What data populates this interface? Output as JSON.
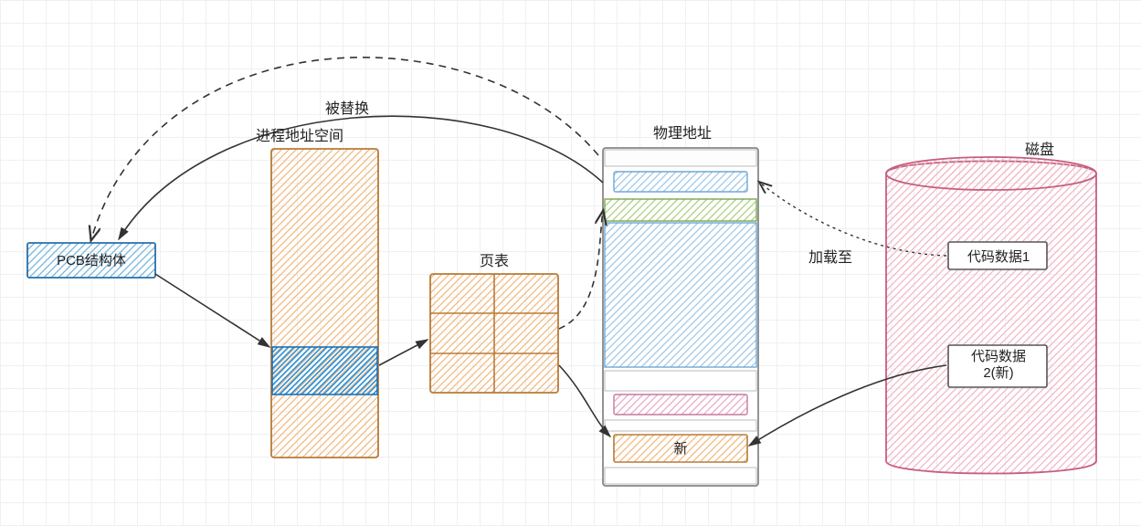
{
  "labels": {
    "replaced": "被替换",
    "proc_space": "进程地址空间",
    "page_table": "页表",
    "phys_addr": "物理地址",
    "disk": "磁盘",
    "pcb": "PCB结构体",
    "load_to": "加载至",
    "code1": "代码数据1",
    "code2_line1": "代码数据",
    "code2_line2": "2(新)",
    "new": "新"
  }
}
